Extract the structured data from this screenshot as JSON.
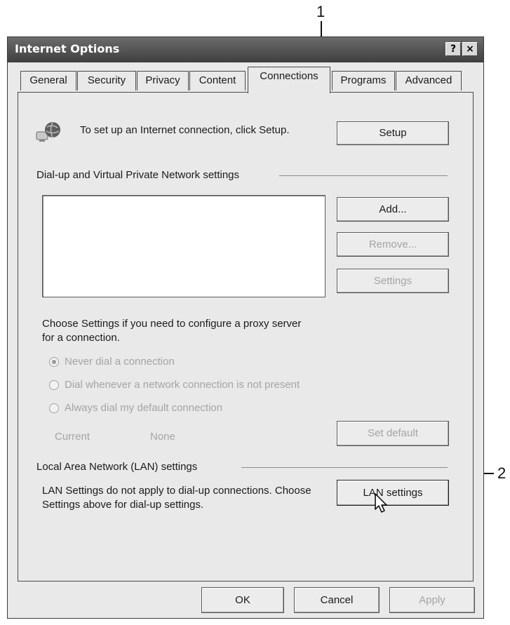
{
  "callouts": {
    "one": "1",
    "two": "2"
  },
  "window": {
    "title": "Internet Options",
    "help_button": "?",
    "close_button": "×"
  },
  "tabs": [
    {
      "label": "General"
    },
    {
      "label": "Security"
    },
    {
      "label": "Privacy"
    },
    {
      "label": "Content"
    },
    {
      "label": "Connections",
      "active": true
    },
    {
      "label": "Programs"
    },
    {
      "label": "Advanced"
    }
  ],
  "connections": {
    "setup_text": "To set up an Internet connection, click Setup.",
    "setup_button": "Setup",
    "dialup_group": "Dial-up and Virtual Private Network settings",
    "add_button": "Add...",
    "remove_button": "Remove...",
    "settings_button": "Settings",
    "proxy_text": "Choose Settings if you need to configure a proxy server for a connection.",
    "radio_never": "Never dial a connection",
    "radio_whenever": "Dial whenever a network connection is not present",
    "radio_always": "Always dial my default connection",
    "current_label": "Current",
    "current_value": "None",
    "set_default_button": "Set default",
    "lan_group": "Local Area Network (LAN) settings",
    "lan_text": "LAN Settings do not apply to dial-up connections. Choose Settings above for dial-up settings.",
    "lan_button": "LAN settings"
  },
  "footer": {
    "ok": "OK",
    "cancel": "Cancel",
    "apply": "Apply"
  },
  "icons": [
    "globe-network-icon",
    "mouse-cursor-icon"
  ]
}
